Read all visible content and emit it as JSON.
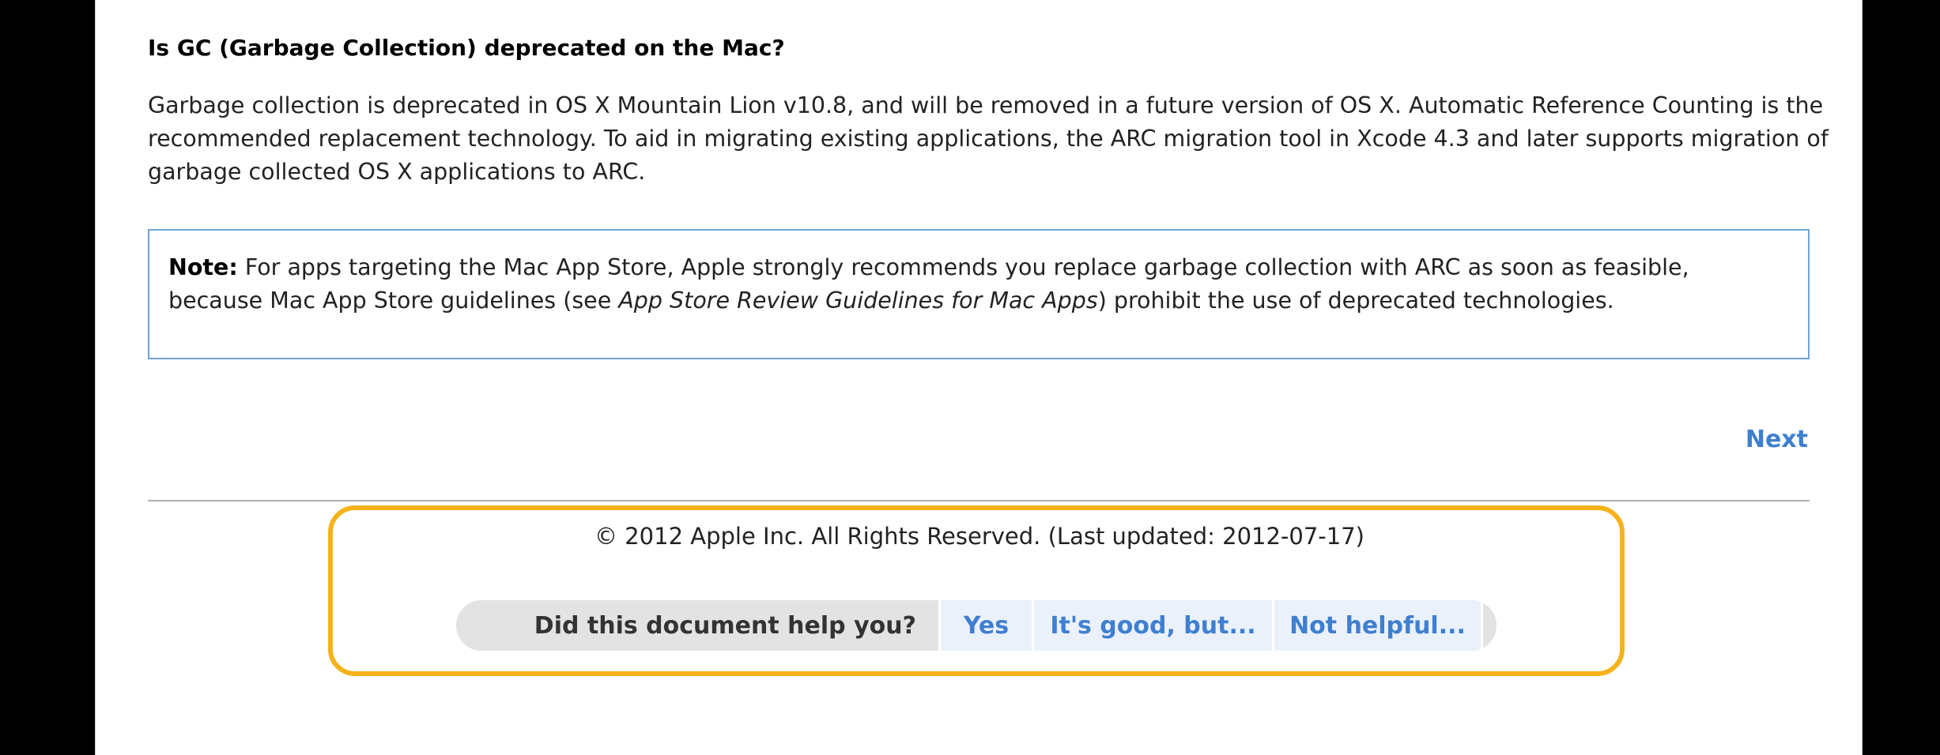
{
  "faq": {
    "question": "Is GC (Garbage Collection) deprecated on the Mac?",
    "answer": "Garbage collection is deprecated in OS X Mountain Lion v10.8, and will be removed in a future version of OS X. Automatic Reference Counting is the recommended replacement technology. To aid in migrating existing applications, the ARC migration tool in Xcode 4.3 and later supports migration of garbage collected OS X applications to ARC."
  },
  "note": {
    "label": "Note:",
    "text_before": " For apps targeting the Mac App Store, Apple strongly recommends you replace garbage collection with ARC as soon as feasible, because Mac App Store guidelines (see ",
    "reference": "App Store Review Guidelines for Mac Apps",
    "text_after": ") prohibit the use of deprecated technologies."
  },
  "navigation": {
    "next_label": "Next"
  },
  "footer": {
    "copyright": "© 2012 Apple Inc. All Rights Reserved. (Last updated: 2012-07-17)",
    "feedback_question": "Did this document help you?",
    "options": [
      "Yes",
      "It's good, but...",
      "Not helpful..."
    ]
  },
  "colors": {
    "link": "#3f7fd1",
    "note_border": "#6fa3d6",
    "highlight": "#f5b21a"
  }
}
